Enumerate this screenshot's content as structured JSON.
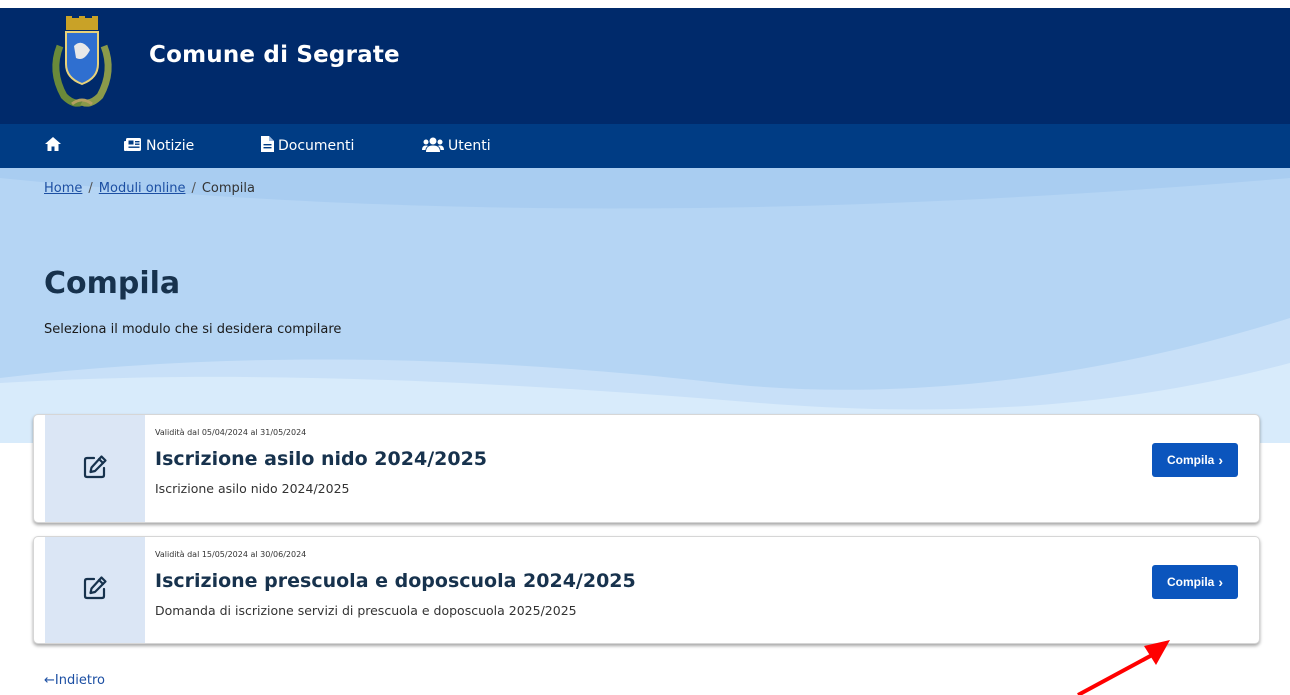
{
  "header": {
    "site_title": "Comune di Segrate"
  },
  "nav": {
    "items": [
      {
        "label": "",
        "icon": "home-icon"
      },
      {
        "label": "Notizie",
        "icon": "newspaper-icon"
      },
      {
        "label": "Documenti",
        "icon": "document-icon"
      },
      {
        "label": "Utenti",
        "icon": "users-icon"
      }
    ]
  },
  "breadcrumb": {
    "home": "Home",
    "moduli": "Moduli online",
    "current": "Compila",
    "separator": "/"
  },
  "page": {
    "title": "Compila",
    "subtitle": "Seleziona il modulo che si desidera compilare"
  },
  "forms": [
    {
      "validity": "Validità dal 05/04/2024 al 31/05/2024",
      "title": "Iscrizione asilo nido 2024/2025",
      "description": "Iscrizione asilo nido 2024/2025",
      "button_label": "Compila",
      "icon": "edit-icon"
    },
    {
      "validity": "Validità dal 15/05/2024 al 30/06/2024",
      "title": "Iscrizione prescuola e doposcuola 2024/2025",
      "description": "Domanda di iscrizione servizi di prescuola e doposcuola 2025/2025",
      "button_label": "Compila",
      "icon": "edit-icon"
    }
  ],
  "footer": {
    "back_label": "Indietro"
  },
  "colors": {
    "header": "#002a6b",
    "navbar": "#003c84",
    "hero": "#b5d5f4",
    "button": "#0b55bd",
    "annotation_arrow": "#ff0000"
  }
}
